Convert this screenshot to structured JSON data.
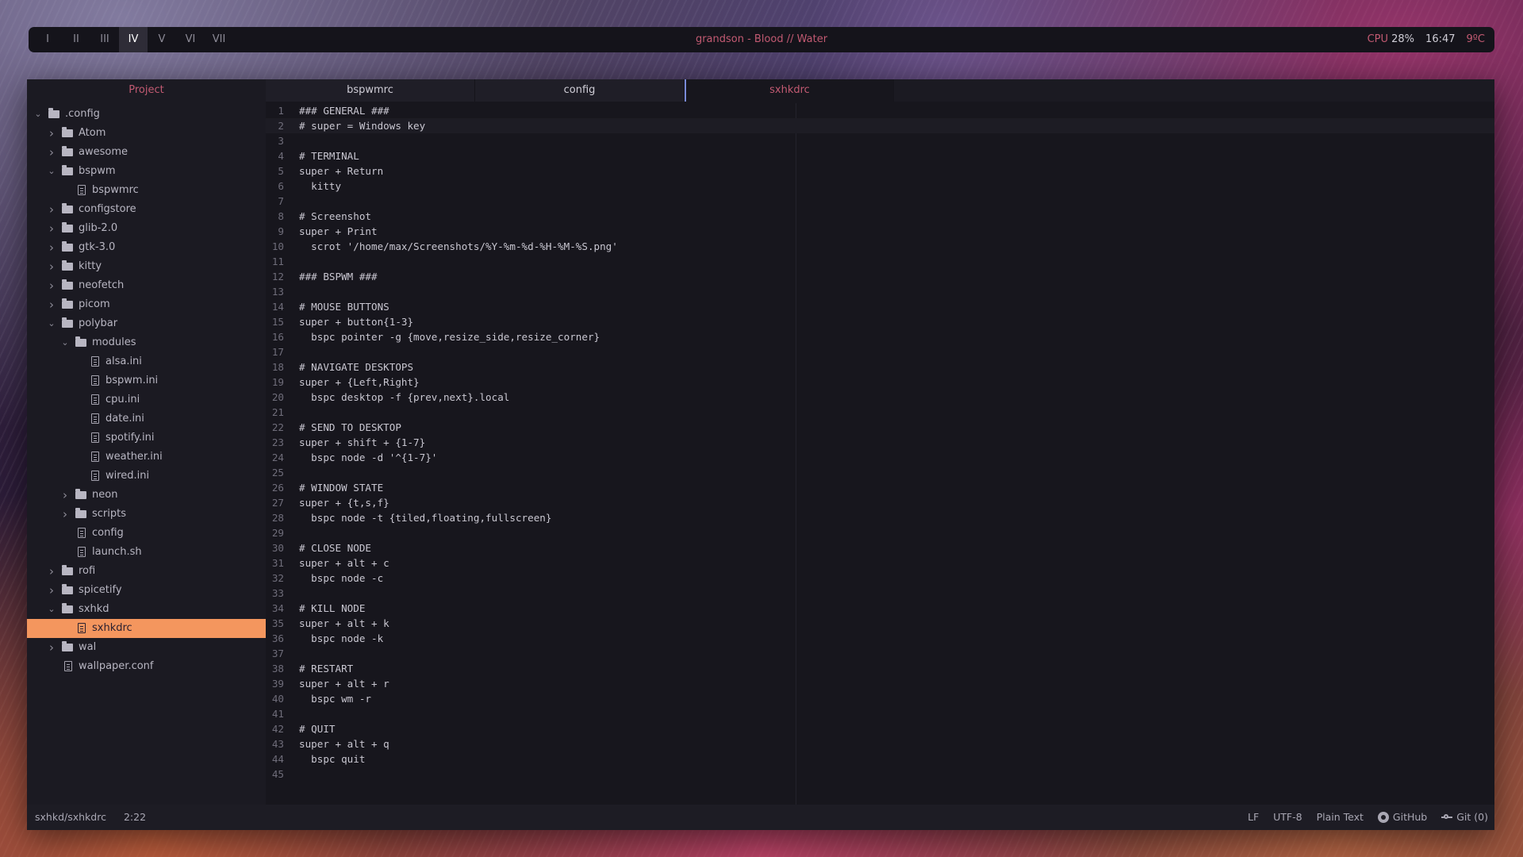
{
  "topbar": {
    "workspaces": [
      "I",
      "II",
      "III",
      "IV",
      "V",
      "VI",
      "VII"
    ],
    "active_workspace": "IV",
    "now_playing": "grandson - Blood // Water",
    "cpu_label": "CPU",
    "cpu_value": "28%",
    "clock": "16:47",
    "temperature": "9ºC"
  },
  "sidebar": {
    "header": "Project",
    "tree": [
      {
        "label": ".config",
        "type": "folder",
        "depth": 0,
        "expanded": true
      },
      {
        "label": "Atom",
        "type": "folder",
        "depth": 1,
        "expanded": false
      },
      {
        "label": "awesome",
        "type": "folder",
        "depth": 1,
        "expanded": false
      },
      {
        "label": "bspwm",
        "type": "folder",
        "depth": 1,
        "expanded": true
      },
      {
        "label": "bspwmrc",
        "type": "file",
        "depth": 2
      },
      {
        "label": "configstore",
        "type": "folder",
        "depth": 1,
        "expanded": false
      },
      {
        "label": "glib-2.0",
        "type": "folder",
        "depth": 1,
        "expanded": false
      },
      {
        "label": "gtk-3.0",
        "type": "folder",
        "depth": 1,
        "expanded": false
      },
      {
        "label": "kitty",
        "type": "folder",
        "depth": 1,
        "expanded": false
      },
      {
        "label": "neofetch",
        "type": "folder",
        "depth": 1,
        "expanded": false
      },
      {
        "label": "picom",
        "type": "folder",
        "depth": 1,
        "expanded": false
      },
      {
        "label": "polybar",
        "type": "folder",
        "depth": 1,
        "expanded": true
      },
      {
        "label": "modules",
        "type": "folder",
        "depth": 2,
        "expanded": true
      },
      {
        "label": "alsa.ini",
        "type": "file",
        "depth": 3
      },
      {
        "label": "bspwm.ini",
        "type": "file",
        "depth": 3
      },
      {
        "label": "cpu.ini",
        "type": "file",
        "depth": 3
      },
      {
        "label": "date.ini",
        "type": "file",
        "depth": 3
      },
      {
        "label": "spotify.ini",
        "type": "file",
        "depth": 3
      },
      {
        "label": "weather.ini",
        "type": "file",
        "depth": 3
      },
      {
        "label": "wired.ini",
        "type": "file",
        "depth": 3
      },
      {
        "label": "neon",
        "type": "folder",
        "depth": 2,
        "expanded": false
      },
      {
        "label": "scripts",
        "type": "folder",
        "depth": 2,
        "expanded": false
      },
      {
        "label": "config",
        "type": "file",
        "depth": 2
      },
      {
        "label": "launch.sh",
        "type": "file",
        "depth": 2
      },
      {
        "label": "rofi",
        "type": "folder",
        "depth": 1,
        "expanded": false
      },
      {
        "label": "spicetify",
        "type": "folder",
        "depth": 1,
        "expanded": false
      },
      {
        "label": "sxhkd",
        "type": "folder",
        "depth": 1,
        "expanded": true
      },
      {
        "label": "sxhkdrc",
        "type": "file",
        "depth": 2,
        "selected": true
      },
      {
        "label": "wal",
        "type": "folder",
        "depth": 1,
        "expanded": false
      },
      {
        "label": "wallpaper.conf",
        "type": "file",
        "depth": 1
      }
    ]
  },
  "tabs": [
    {
      "label": "bspwmrc",
      "active": false
    },
    {
      "label": "config",
      "active": false
    },
    {
      "label": "sxhkdrc",
      "active": true
    }
  ],
  "editor": {
    "current_line": 2,
    "lines": [
      "### GENERAL ###",
      "# super = Windows key",
      "",
      "# TERMINAL",
      "super + Return",
      "  kitty",
      "",
      "# Screenshot",
      "super + Print",
      "  scrot '/home/max/Screenshots/%Y-%m-%d-%H-%M-%S.png'",
      "",
      "### BSPWM ###",
      "",
      "# MOUSE BUTTONS",
      "super + button{1-3}",
      "  bspc pointer -g {move,resize_side,resize_corner}",
      "",
      "# NAVIGATE DESKTOPS",
      "super + {Left,Right}",
      "  bspc desktop -f {prev,next}.local",
      "",
      "# SEND TO DESKTOP",
      "super + shift + {1-7}",
      "  bspc node -d '^{1-7}'",
      "",
      "# WINDOW STATE",
      "super + {t,s,f}",
      "  bspc node -t {tiled,floating,fullscreen}",
      "",
      "# CLOSE NODE",
      "super + alt + c",
      "  bspc node -c",
      "",
      "# KILL NODE",
      "super + alt + k",
      "  bspc node -k",
      "",
      "# RESTART",
      "super + alt + r",
      "  bspc wm -r",
      "",
      "# QUIT",
      "super + alt + q",
      "  bspc quit",
      ""
    ]
  },
  "statusbar": {
    "file_path": "sxhkd/sxhkdrc",
    "cursor": "2:22",
    "line_ending": "LF",
    "encoding": "UTF-8",
    "grammar": "Plain Text",
    "github_label": "GitHub",
    "git_label": "Git (0)"
  }
}
